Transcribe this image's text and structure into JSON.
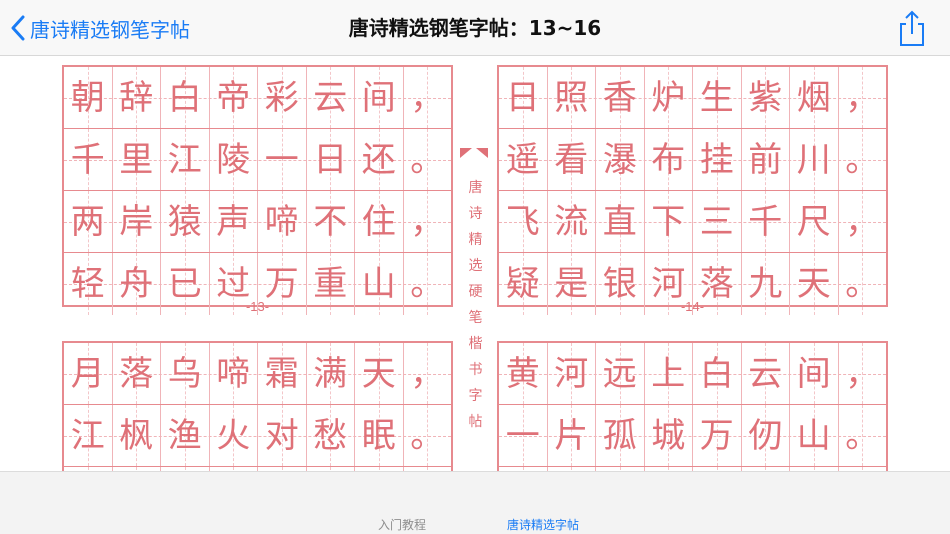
{
  "nav": {
    "back_label": "唐诗精选钢笔字帖",
    "title": "唐诗精选钢笔字帖：13~16",
    "accent": "#1a7cf5"
  },
  "pages": [
    {
      "page_label": "-13-",
      "rows": [
        [
          "朝",
          "辞",
          "白",
          "帝",
          "彩",
          "云",
          "间",
          "，"
        ],
        [
          "千",
          "里",
          "江",
          "陵",
          "一",
          "日",
          "还",
          "。"
        ],
        [
          "两",
          "岸",
          "猿",
          "声",
          "啼",
          "不",
          "住",
          "，"
        ],
        [
          "轻",
          "舟",
          "已",
          "过",
          "万",
          "重",
          "山",
          "。"
        ]
      ]
    },
    {
      "page_label": "-14-",
      "rows": [
        [
          "日",
          "照",
          "香",
          "炉",
          "生",
          "紫",
          "烟",
          "，"
        ],
        [
          "遥",
          "看",
          "瀑",
          "布",
          "挂",
          "前",
          "川",
          "。"
        ],
        [
          "飞",
          "流",
          "直",
          "下",
          "三",
          "千",
          "尺",
          "，"
        ],
        [
          "疑",
          "是",
          "银",
          "河",
          "落",
          "九",
          "天",
          "。"
        ]
      ]
    },
    {
      "page_label": "",
      "rows": [
        [
          "月",
          "落",
          "乌",
          "啼",
          "霜",
          "满",
          "天",
          "，"
        ],
        [
          "江",
          "枫",
          "渔",
          "火",
          "对",
          "愁",
          "眠",
          "。"
        ],
        [
          "",
          "",
          "",
          "",
          "",
          "",
          "",
          ""
        ]
      ]
    },
    {
      "page_label": "",
      "rows": [
        [
          "黄",
          "河",
          "远",
          "上",
          "白",
          "云",
          "间",
          "，"
        ],
        [
          "一",
          "片",
          "孤",
          "城",
          "万",
          "仞",
          "山",
          "。"
        ],
        [
          "",
          "",
          "",
          "",
          "",
          "",
          "",
          ""
        ]
      ]
    }
  ],
  "spine": [
    "唐",
    "诗",
    "精",
    "选",
    "硬",
    "笔",
    "楷",
    "书",
    "字",
    "帖"
  ],
  "tabs": [
    {
      "label": "入门教程",
      "selected": false
    },
    {
      "label": "唐诗精选字帖",
      "selected": true
    }
  ],
  "colors": {
    "grid": "#e78a8f",
    "ink": "#df7178"
  },
  "icons": {
    "back": "chevron-left-icon",
    "share": "share-icon"
  }
}
